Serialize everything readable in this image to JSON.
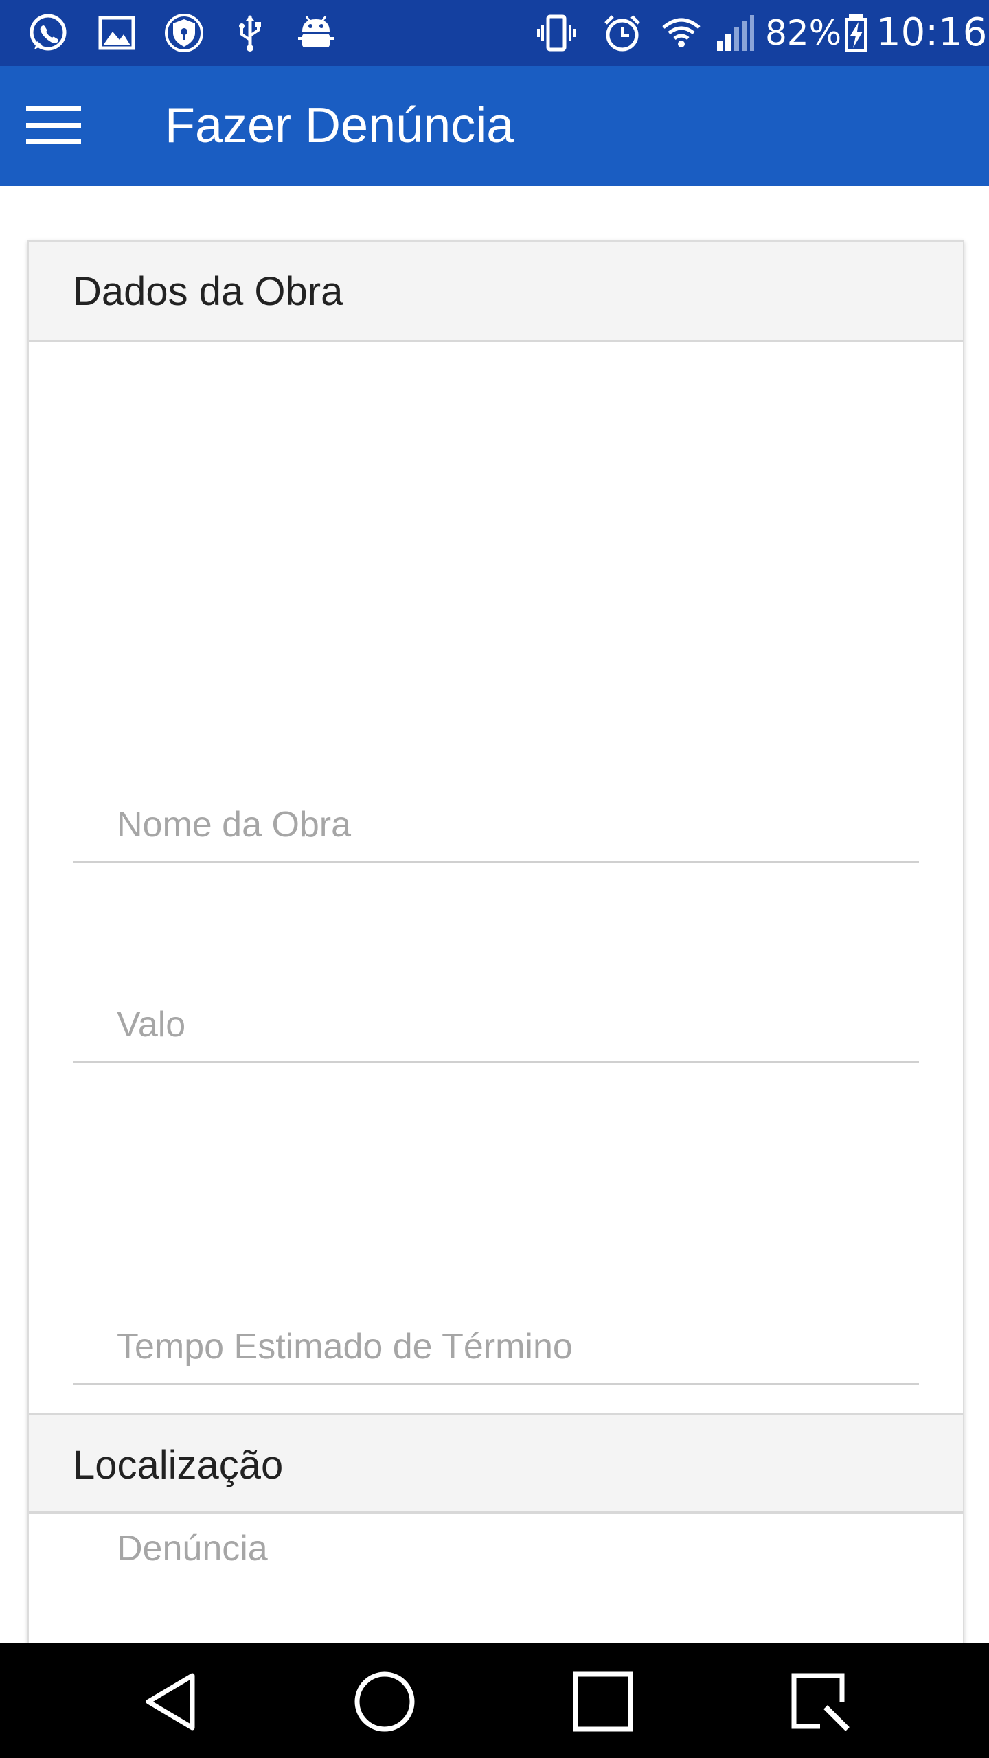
{
  "status_bar": {
    "battery_percent": "82%",
    "time": "10:16",
    "left_icons": [
      "whatsapp-icon",
      "gallery-icon",
      "vpn-shield-icon",
      "usb-icon",
      "android-debug-icon"
    ],
    "right_icons": [
      "vibrate-icon",
      "alarm-icon",
      "wifi-icon",
      "signal-icon",
      "battery-charging-icon"
    ]
  },
  "app_bar": {
    "title": "Fazer Denúncia",
    "menu_icon": "hamburger-menu-icon",
    "color": "#1a5dc2"
  },
  "form": {
    "section_obra": {
      "title": "Dados da Obra",
      "fields": {
        "nome": {
          "placeholder": "Nome da Obra",
          "value": ""
        },
        "valor": {
          "placeholder": "Valo",
          "value": ""
        },
        "tempo": {
          "placeholder": "Tempo Estimado de Término",
          "value": ""
        },
        "denuncia": {
          "placeholder": "Denúncia",
          "value": ""
        }
      }
    },
    "section_localizacao": {
      "title": "Localização"
    }
  },
  "nav_bar": {
    "buttons": [
      "back-icon",
      "home-icon",
      "recents-icon",
      "screenshot-icon"
    ]
  },
  "colors": {
    "status_bar": "#1440a0",
    "app_bar": "#1a5dc2",
    "placeholder": "#a6a6a6",
    "section_header_bg": "#f4f4f4"
  }
}
